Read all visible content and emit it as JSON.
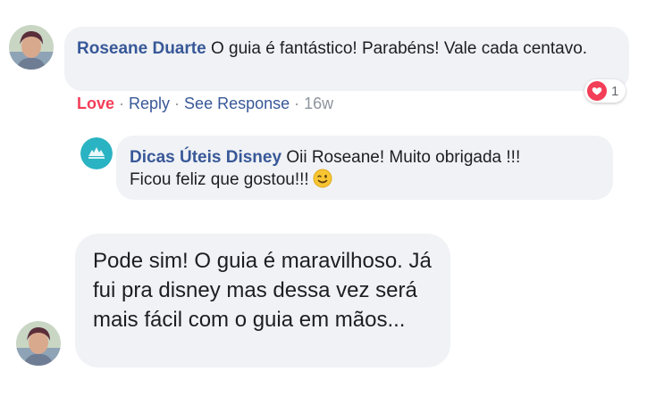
{
  "comment1": {
    "author": "Roseane Duarte",
    "text": "O guia é fantástico! Parabéns! Vale cada centavo.",
    "actions": {
      "love": "Love",
      "reply": "Reply",
      "see_response": "See Response",
      "time": "16w"
    },
    "reaction": {
      "icon": "heart-icon",
      "count": "1"
    }
  },
  "reply1": {
    "author": "Dicas Úteis Disney",
    "text_line1": "Oii Roseane! Muito obrigada !!!",
    "text_line2": "Ficou feliz que gostou!!!",
    "emoji": "winking-face-icon"
  },
  "comment2": {
    "text": "Pode sim! O guia é maravilhoso. Já fui pra disney mas dessa vez será mais fácil com o guia em mãos..."
  },
  "colors": {
    "name": "#385898",
    "love": "#f33e58",
    "bubble": "#f0f2f5",
    "meta": "#8d949e"
  }
}
